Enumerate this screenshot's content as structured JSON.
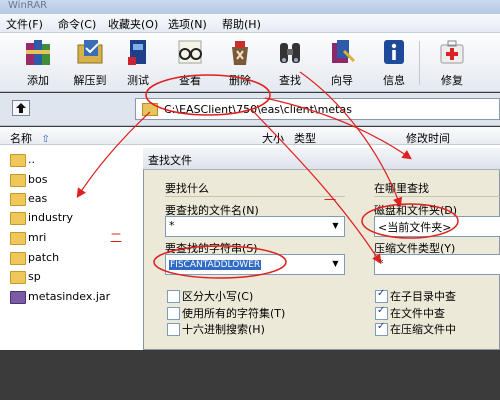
{
  "title": "WinRAR",
  "menu": [
    "文件(F)",
    "命令(C)",
    "收藏夹(O)",
    "选项(N)",
    "帮助(H)"
  ],
  "toolbar": [
    {
      "label": "添加",
      "icon": "books-icon"
    },
    {
      "label": "解压到",
      "icon": "extract-folder-icon"
    },
    {
      "label": "测试",
      "icon": "test-book-icon"
    },
    {
      "label": "查看",
      "icon": "glasses-icon"
    },
    {
      "label": "删除",
      "icon": "delete-bag-icon"
    },
    {
      "label": "查找",
      "icon": "binoculars-icon"
    },
    {
      "label": "向导",
      "icon": "wizard-icon"
    },
    {
      "label": "信息",
      "icon": "info-icon"
    },
    {
      "label": "修复",
      "icon": "first-aid-icon"
    }
  ],
  "address": "C:\\EASClient\\750\\eas\\client\\metas",
  "columns": {
    "name": "名称",
    "size": "大小",
    "type": "类型",
    "modified": "修改时间"
  },
  "files": [
    {
      "name": ".."
    },
    {
      "name": "bos"
    },
    {
      "name": "eas"
    },
    {
      "name": "industry"
    },
    {
      "name": "mri"
    },
    {
      "name": "patch"
    },
    {
      "name": "sp"
    },
    {
      "name": "metasindex.jar"
    }
  ],
  "dialog": {
    "title": "查找文件",
    "what_group": "要找什么",
    "filename_label": "要查找的文件名(N)",
    "filename_value": "*",
    "string_label": "要查找的字符串(S)",
    "string_value": "FISCANTADDLOWER",
    "checks": [
      {
        "label": "区分大小写(C)",
        "checked": false
      },
      {
        "label": "使用所有的字符集(T)",
        "checked": false
      },
      {
        "label": "十六进制搜索(H)",
        "checked": false
      }
    ],
    "where_group": "在哪里查找",
    "disk_label": "磁盘和文件夹(D)",
    "disk_value": "<当前文件夹>",
    "archive_types_label": "压缩文件类型(Y)",
    "archive_types_value": "*",
    "where_checks": [
      {
        "label": "在子目录中查",
        "checked": true
      },
      {
        "label": "在文件中查",
        "checked": true
      },
      {
        "label": "在压缩文件中",
        "checked": true
      }
    ]
  },
  "annotations": {
    "mark1": "一",
    "mark2": "二"
  },
  "colors": {
    "annotation": "#e02020",
    "selection": "#316ac5"
  }
}
